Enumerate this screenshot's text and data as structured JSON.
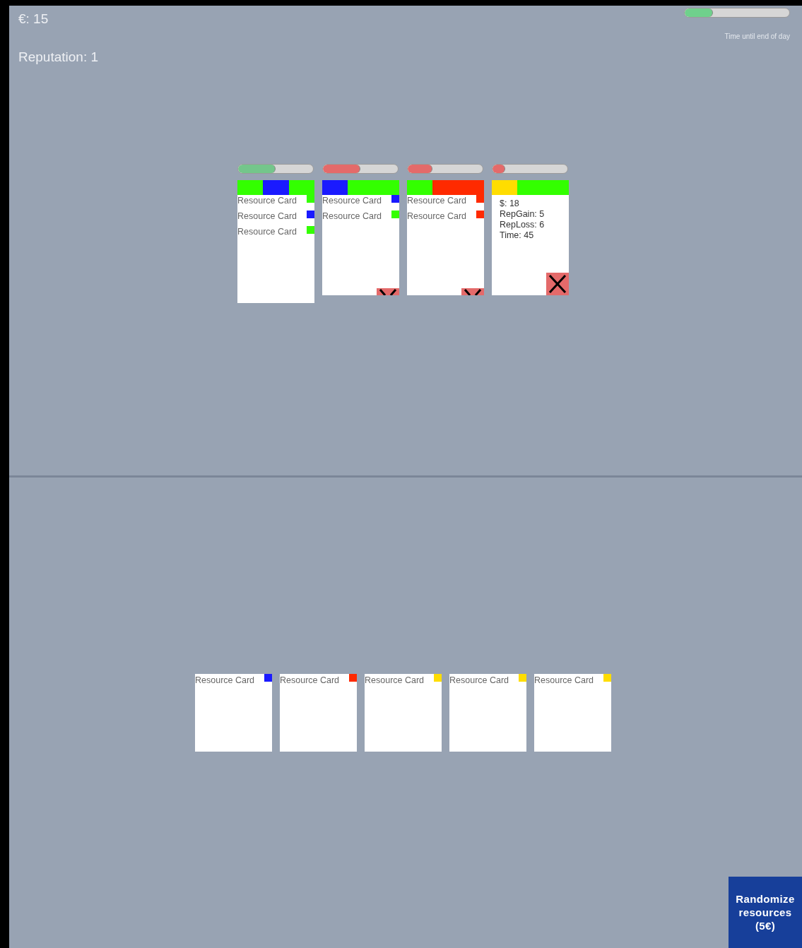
{
  "stats": {
    "money": "€: 15",
    "reputation": "Reputation: 1"
  },
  "day_timer": {
    "level": 0.27,
    "label": "Time until end of day"
  },
  "orders": [
    {
      "timer": {
        "level": 0.5,
        "color": "#74c68b"
      },
      "segments": [
        {
          "color": "#33ff00"
        },
        {
          "color": "#1a1aff"
        },
        {
          "color": "#33ff00"
        }
      ],
      "kind": "resources",
      "items": [
        {
          "label": "Resource Card",
          "color": "#33ff00"
        },
        {
          "label": "Resource Card",
          "color": "#1a1aff"
        },
        {
          "label": "Resource Card",
          "color": "#33ff00"
        }
      ]
    },
    {
      "timer": {
        "level": 0.5,
        "color": "#e46a6a"
      },
      "segments": [
        {
          "color": "#1a1aff"
        },
        {
          "color": "#33ff00"
        },
        {
          "color": "#33ff00"
        }
      ],
      "kind": "resources",
      "close_button": {
        "clipped": true
      },
      "items": [
        {
          "label": "Resource Card",
          "color": "#1a1aff"
        },
        {
          "label": "Resource Card",
          "color": "#33ff00"
        }
      ]
    },
    {
      "timer": {
        "level": 0.33,
        "color": "#e46a6a"
      },
      "segments": [
        {
          "color": "#33ff00"
        },
        {
          "color": "#ff2a00"
        },
        {
          "color": "#ff2a00"
        }
      ],
      "kind": "resources",
      "close_button": {
        "clipped": true
      },
      "items": [
        {
          "label": "Resource Card",
          "color": "#ff2a00"
        },
        {
          "label": "Resource Card",
          "color": "#ff2a00"
        }
      ]
    },
    {
      "timer": {
        "level": 0.17,
        "color": "#e46a6a"
      },
      "segments": [
        {
          "color": "#ffdd00"
        },
        {
          "color": "#33ff00"
        },
        {
          "color": "#33ff00"
        }
      ],
      "kind": "stats",
      "close_button": {
        "clipped": false
      },
      "lines": [
        "$: 18",
        "RepGain: 5",
        "RepLoss: 6",
        "Time: 45"
      ]
    }
  ],
  "hand": [
    {
      "label": "Resource Card",
      "color": "#1a1aff"
    },
    {
      "label": "Resource Card",
      "color": "#ff2a00"
    },
    {
      "label": "Resource Card",
      "color": "#ffdd00"
    },
    {
      "label": "Resource Card",
      "color": "#ffdd00"
    },
    {
      "label": "Resource Card",
      "color": "#ffdd00"
    }
  ],
  "randomize_button": {
    "label": "Randomize resources (5€)"
  }
}
